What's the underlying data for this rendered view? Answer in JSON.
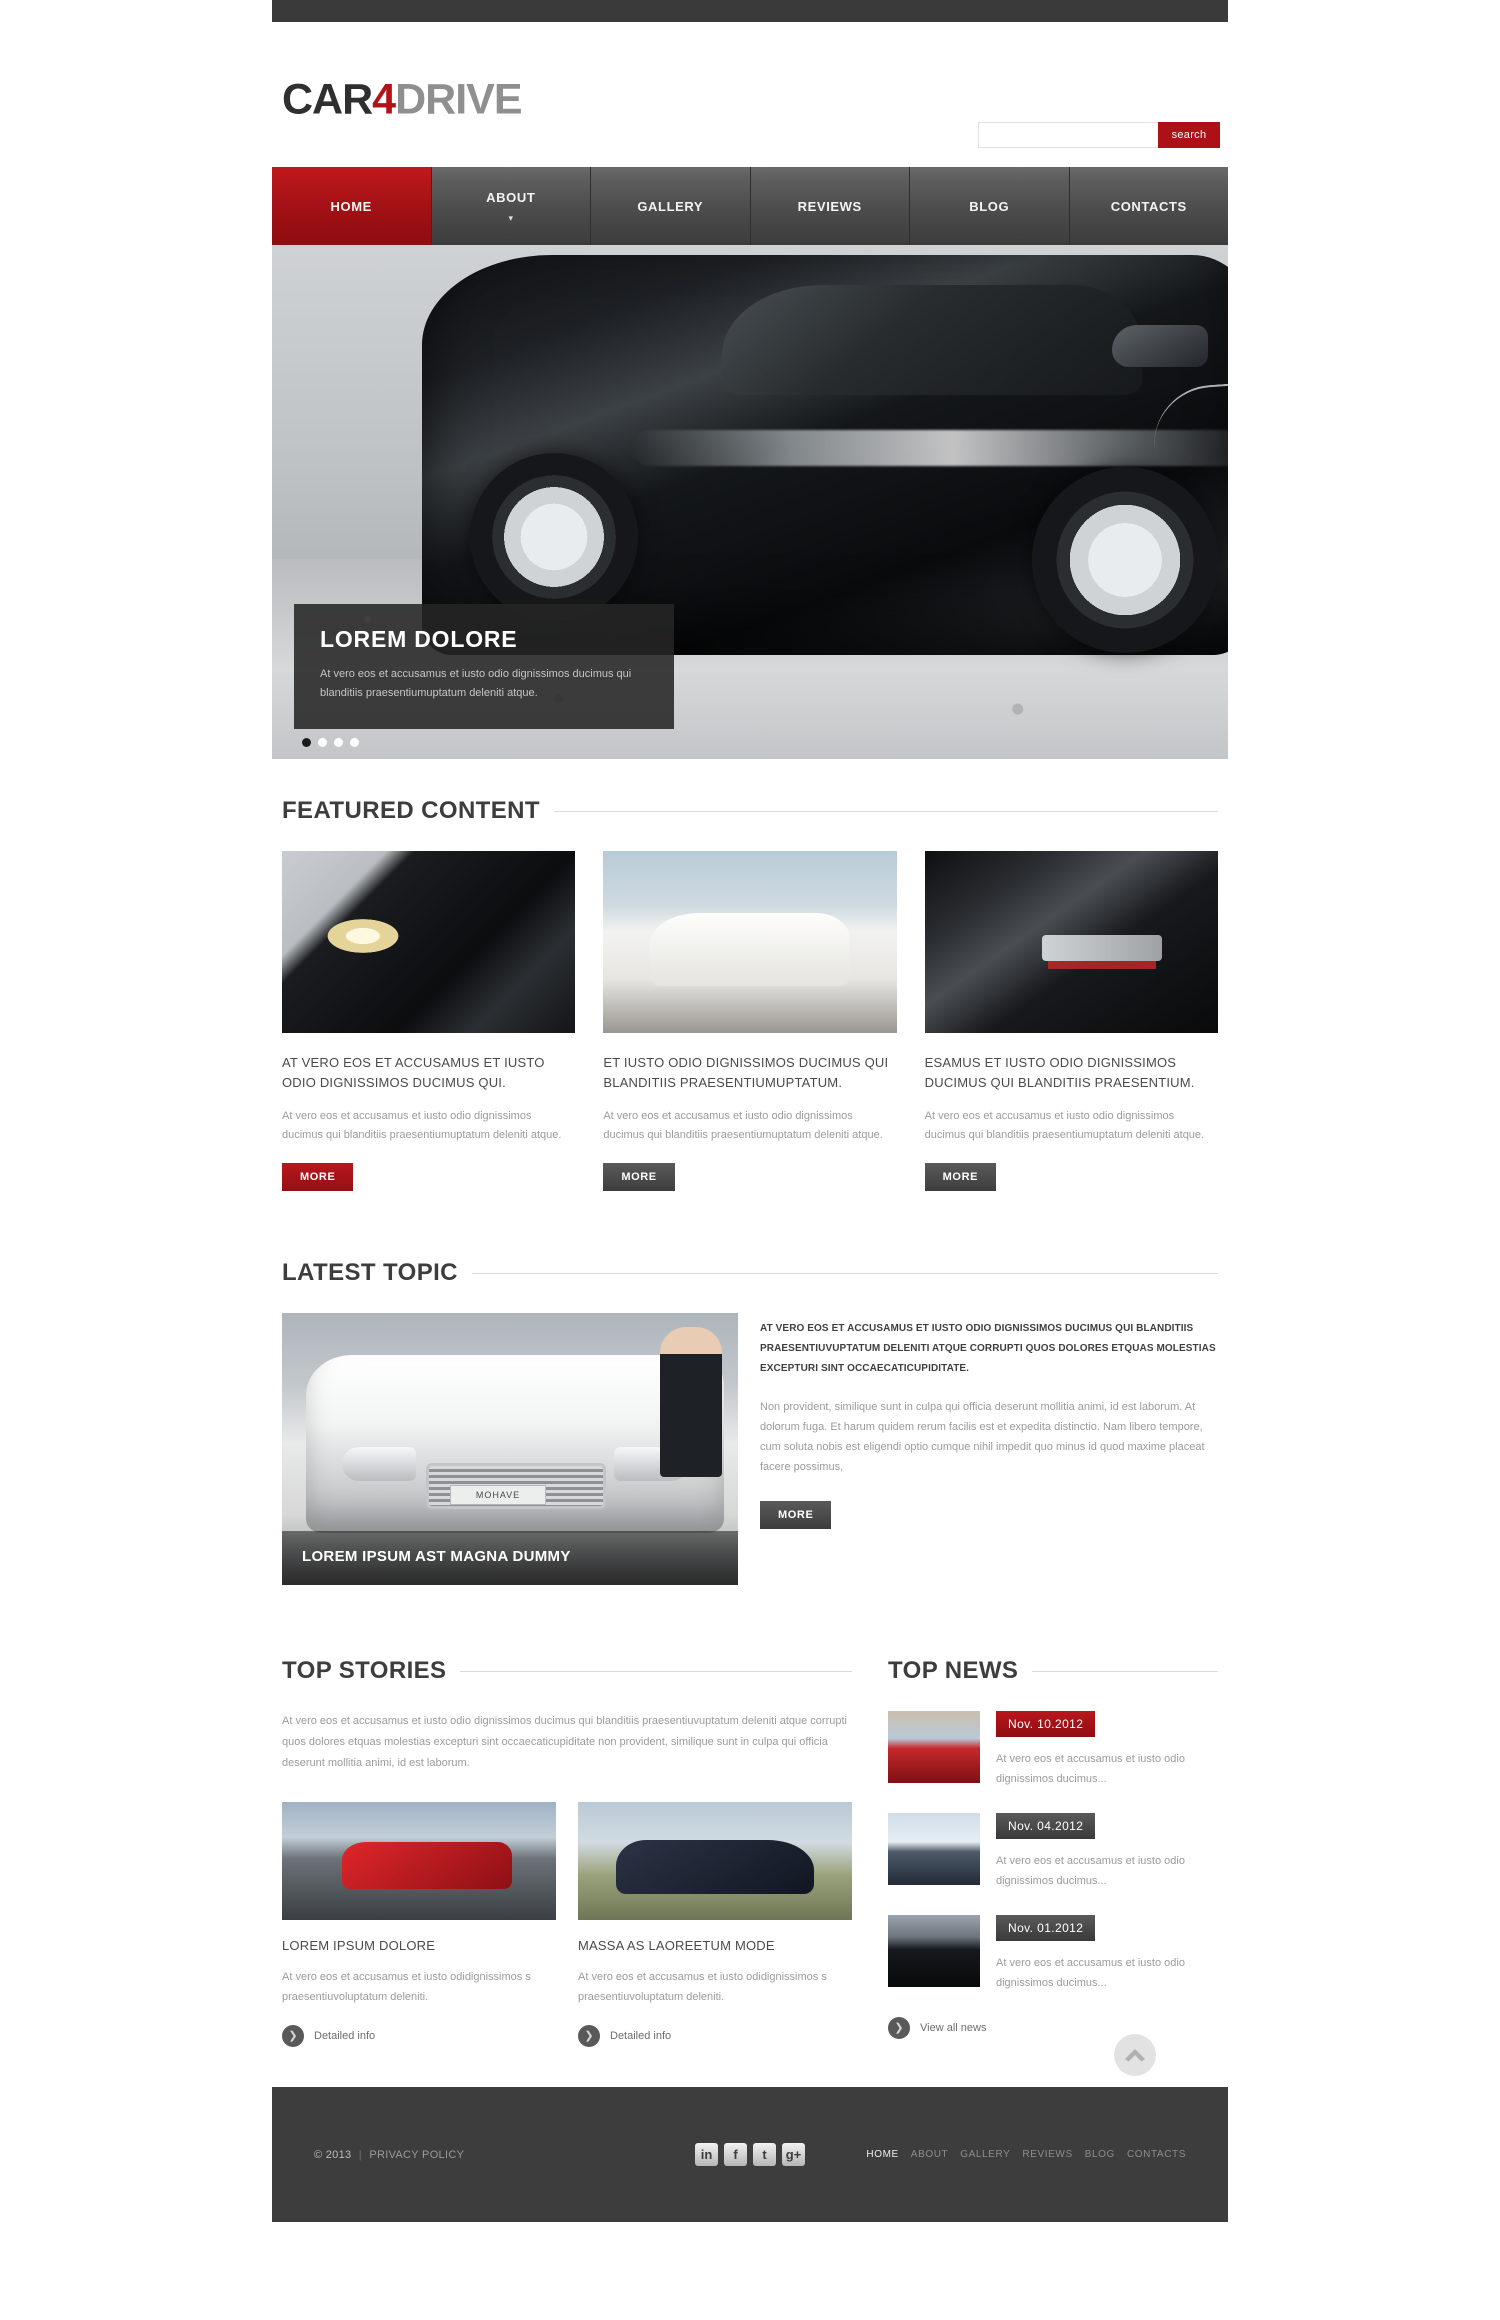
{
  "brand": {
    "part1": "CAR",
    "part2": "4",
    "part3": "DRIVE"
  },
  "search": {
    "value": "",
    "placeholder": "",
    "button_label": "search"
  },
  "nav": {
    "items": [
      {
        "label": "HOME",
        "active": true,
        "caret": ""
      },
      {
        "label": "ABOUT",
        "active": false,
        "caret": "▾"
      },
      {
        "label": "GALLERY",
        "active": false,
        "caret": ""
      },
      {
        "label": "REVIEWS",
        "active": false,
        "caret": ""
      },
      {
        "label": "BLOG",
        "active": false,
        "caret": ""
      },
      {
        "label": "CONTACTS",
        "active": false,
        "caret": ""
      }
    ]
  },
  "slider": {
    "caption_title": "LOREM DOLORE",
    "caption_text": "At vero eos et accusamus et iusto odio dignissimos ducimus qui blanditiis praesentiumuptatum deleniti atque.",
    "dots": 4,
    "active_dot": 0
  },
  "featured": {
    "heading": "FEATURED CONTENT",
    "columns": [
      {
        "title": "AT VERO EOS ET ACCUSAMUS ET IUSTO ODIO DIGNISSIMOS DUCIMUS QUI.",
        "text": "At vero eos et accusamus et iusto odio dignissimos ducimus qui blanditiis praesentiumuptatum deleniti atque.",
        "button": "MORE",
        "button_style": "red"
      },
      {
        "title": "ET IUSTO ODIO DIGNISSIMOS DUCIMUS QUI BLANDITIIS PRAESENTIUMUPTATUM.",
        "text": "At vero eos et accusamus et iusto odio dignissimos ducimus qui blanditiis praesentiumuptatum deleniti atque.",
        "button": "MORE",
        "button_style": "dark"
      },
      {
        "title": "ESAMUS ET IUSTO ODIO DIGNISSIMOS DUCIMUS QUI BLANDITIIS PRAESENTIUM.",
        "text": "At vero eos et accusamus et iusto odio dignissimos ducimus qui blanditiis praesentiumuptatum deleniti atque.",
        "button": "MORE",
        "button_style": "dark"
      }
    ]
  },
  "latest_topic": {
    "heading": "LATEST TOPIC",
    "image_caption": "LOREM IPSUM AST MAGNA DUMMY",
    "plate": "MOHAVE",
    "lead": "AT VERO EOS ET ACCUSAMUS ET IUSTO ODIO DIGNISSIMOS DUCIMUS QUI BLANDITIIS PRAESENTIUVUPTATUM DELENITI ATQUE CORRUPTI QUOS DOLORES ETQUAS MOLESTIAS EXCEPTURI SINT OCCAECATICUPIDITATE.",
    "body": "Non provident, similique sunt in culpa qui officia deserunt mollitia animi, id est laborum. At dolorum fuga. Et harum quidem rerum facilis est et expedita distinctio. Nam libero tempore, cum soluta nobis est eligendi optio cumque nihil impedit quo minus id quod maxime placeat facere possimus,",
    "button": "MORE"
  },
  "top_stories": {
    "heading": "TOP STORIES",
    "intro": "At vero eos et accusamus et iusto odio dignissimos ducimus qui blanditiis praesentiuvuptatum deleniti atque corrupti quos dolores etquas molestias excepturi sint occaecaticupiditate non provident, similique sunt in culpa qui officia deserunt mollitia animi, id est laborum.",
    "stories": [
      {
        "title": "LOREM IPSUM DOLORE",
        "text": "At vero eos et accusamus et iusto odidignissimos s praesentiuvoluptatum deleniti.",
        "link": "Detailed info"
      },
      {
        "title": "MASSA AS LAOREETUM MODE",
        "text": "At vero eos et accusamus et iusto odidignissimos s praesentiuvoluptatum deleniti.",
        "link": "Detailed info"
      }
    ]
  },
  "top_news": {
    "heading": "TOP NEWS",
    "items": [
      {
        "date": "Nov. 10.2012",
        "style": "red",
        "text": "At vero eos et accusamus et iusto odio dignissimos ducimus..."
      },
      {
        "date": "Nov. 04.2012",
        "style": "dark",
        "text": "At vero eos et accusamus et iusto odio dignissimos ducimus..."
      },
      {
        "date": "Nov. 01.2012",
        "style": "dark",
        "text": "At vero eos et accusamus et iusto odio dignissimos ducimus..."
      }
    ],
    "view_all": "View all news"
  },
  "footer": {
    "copyright": "© 2013",
    "separator": "|",
    "privacy": "PRIVACY POLICY",
    "social": [
      {
        "name": "linkedin",
        "glyph": "in"
      },
      {
        "name": "facebook",
        "glyph": "f"
      },
      {
        "name": "twitter",
        "glyph": "t"
      },
      {
        "name": "googleplus",
        "glyph": "g+"
      }
    ],
    "links": [
      {
        "label": "HOME",
        "active": true
      },
      {
        "label": "ABOUT",
        "active": false
      },
      {
        "label": "GALLERY",
        "active": false
      },
      {
        "label": "REVIEWS",
        "active": false
      },
      {
        "label": "BLOG",
        "active": false
      },
      {
        "label": "CONTACTS",
        "active": false
      }
    ]
  },
  "colors": {
    "accent": "#ad1117",
    "dark": "#3d3d3d",
    "muted": "#9b9b9b"
  }
}
